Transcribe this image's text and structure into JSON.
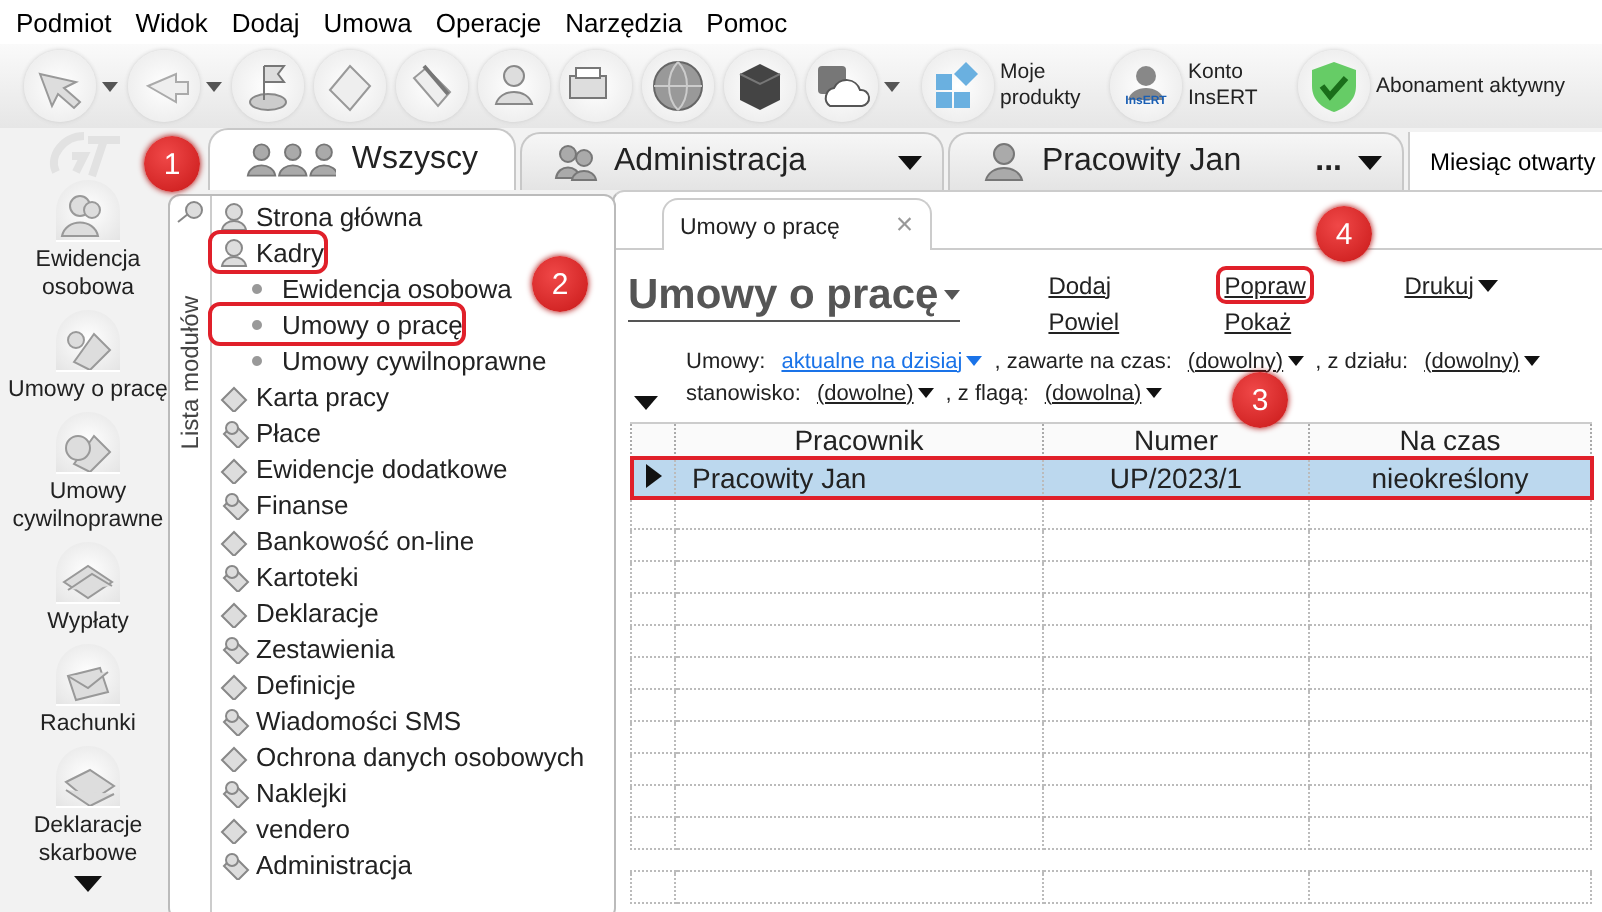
{
  "menu": [
    "Podmiot",
    "Widok",
    "Dodaj",
    "Umowa",
    "Operacje",
    "Narzędzia",
    "Pomoc"
  ],
  "toolbar": [
    {
      "kind": "icon",
      "dropdown": true
    },
    {
      "kind": "icon",
      "dropdown": true
    },
    {
      "kind": "icon",
      "dropdown": false
    },
    {
      "kind": "icon",
      "dropdown": false
    },
    {
      "kind": "icon",
      "dropdown": false
    },
    {
      "kind": "icon",
      "dropdown": false
    },
    {
      "kind": "icon",
      "dropdown": false
    },
    {
      "kind": "icon",
      "dropdown": false
    },
    {
      "kind": "icon",
      "dropdown": false
    },
    {
      "kind": "icon",
      "dropdown": true
    },
    {
      "kind": "labeled",
      "label": "Moje produkty"
    },
    {
      "kind": "labeled",
      "label": "Konto InsERT",
      "badge": "InsERT"
    },
    {
      "kind": "labeled",
      "label": "Abonament aktywny"
    }
  ],
  "tabs": [
    {
      "label": "Wszyscy",
      "selected": true,
      "dropdown": false
    },
    {
      "label": "Administracja",
      "selected": false,
      "dropdown": true
    },
    {
      "label": "Pracowity Jan",
      "selected": false,
      "dropdown": true,
      "more": "..."
    }
  ],
  "period": "Miesiąc otwarty",
  "sidebar": {
    "items": [
      {
        "label": "Ewidencja osobowa"
      },
      {
        "label": "Umowy o pracę"
      },
      {
        "label": "Umowy cywilnoprawne"
      },
      {
        "label": "Wypłaty"
      },
      {
        "label": "Rachunki"
      },
      {
        "label": "Deklaracje skarbowe"
      }
    ]
  },
  "module_list": {
    "title": "Lista modułów",
    "items": [
      {
        "label": "Strona główna",
        "highlighted": false
      },
      {
        "label": "Kadry",
        "highlighted": true,
        "children": [
          {
            "label": "Ewidencja osobowa",
            "highlighted": false
          },
          {
            "label": "Umowy o pracę",
            "highlighted": true
          },
          {
            "label": "Umowy cywilnoprawne",
            "highlighted": false
          }
        ]
      },
      {
        "label": "Karta pracy",
        "highlighted": false
      },
      {
        "label": "Płace",
        "highlighted": false
      },
      {
        "label": "Ewidencje dodatkowe",
        "highlighted": false
      },
      {
        "label": "Finanse",
        "highlighted": false
      },
      {
        "label": "Bankowość on-line",
        "highlighted": false
      },
      {
        "label": "Kartoteki",
        "highlighted": false
      },
      {
        "label": "Deklaracje",
        "highlighted": false
      },
      {
        "label": "Zestawienia",
        "highlighted": false
      },
      {
        "label": "Definicje",
        "highlighted": false
      },
      {
        "label": "Wiadomości SMS",
        "highlighted": false
      },
      {
        "label": "Ochrona danych osobowych",
        "highlighted": false
      },
      {
        "label": "Naklejki",
        "highlighted": false
      },
      {
        "label": "vendero",
        "highlighted": false
      },
      {
        "label": "Administracja",
        "highlighted": false
      }
    ]
  },
  "document": {
    "tab": "Umowy o pracę",
    "close": "×",
    "title": "Umowy o pracę",
    "actions": [
      {
        "label": "Dodaj",
        "highlighted": false,
        "dropdown": false
      },
      {
        "label": "Powiel",
        "highlighted": false,
        "dropdown": false
      },
      {
        "label": "Popraw",
        "highlighted": true,
        "dropdown": false
      },
      {
        "label": "Pokaż",
        "highlighted": false,
        "dropdown": false
      },
      {
        "label": "Drukuj",
        "highlighted": false,
        "dropdown": true
      }
    ],
    "filters": [
      [
        {
          "label": "Umowy:",
          "value": "aktualne na dzisiaj",
          "modified": true
        },
        {
          "label": ", zawarte na czas:",
          "value": "(dowolny)",
          "modified": false
        },
        {
          "label": ", z działu:",
          "value": "(dowolny)",
          "modified": false
        }
      ],
      [
        {
          "label": "stanowisko:",
          "value": "(dowolne)",
          "modified": false
        },
        {
          "label": ", z flagą:",
          "value": "(dowolna)",
          "modified": false
        }
      ]
    ]
  },
  "table": {
    "columns": [
      "Pracownik",
      "Numer",
      "Na czas"
    ],
    "rows": [
      {
        "cells": [
          "Pracowity Jan",
          "UP/2023/1",
          "nieokreślony"
        ],
        "selected": true,
        "highlighted": true
      }
    ]
  },
  "callouts": [
    "1",
    "2",
    "3",
    "4"
  ]
}
